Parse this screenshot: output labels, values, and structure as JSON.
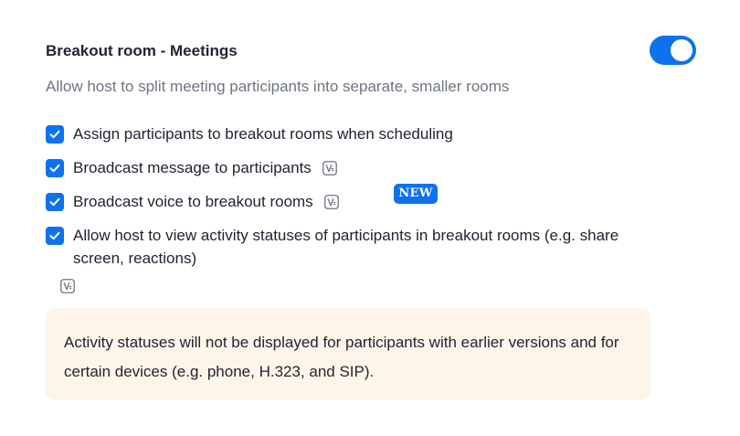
{
  "setting": {
    "title": "Breakout room - Meetings",
    "description": "Allow host to split meeting participants into separate, smaller rooms",
    "enabled": true,
    "accent_color": "#0e72ed"
  },
  "options": [
    {
      "label": "Assign participants to breakout rooms when scheduling",
      "checked": true
    },
    {
      "label": "Broadcast message to participants",
      "checked": true,
      "icon": "version-icon"
    },
    {
      "label": "Broadcast voice to breakout rooms",
      "checked": true,
      "icon": "version-icon",
      "badge": "NEW"
    },
    {
      "label": "Allow host to view activity statuses of participants in breakout rooms (e.g. share screen, reactions)",
      "checked": true,
      "icon": "version-icon"
    }
  ],
  "notice": {
    "text": "Activity statuses will not be displayed for participants with earlier versions and for certain devices (e.g. phone, H.323, and SIP).",
    "background": "#fdf5ea"
  }
}
